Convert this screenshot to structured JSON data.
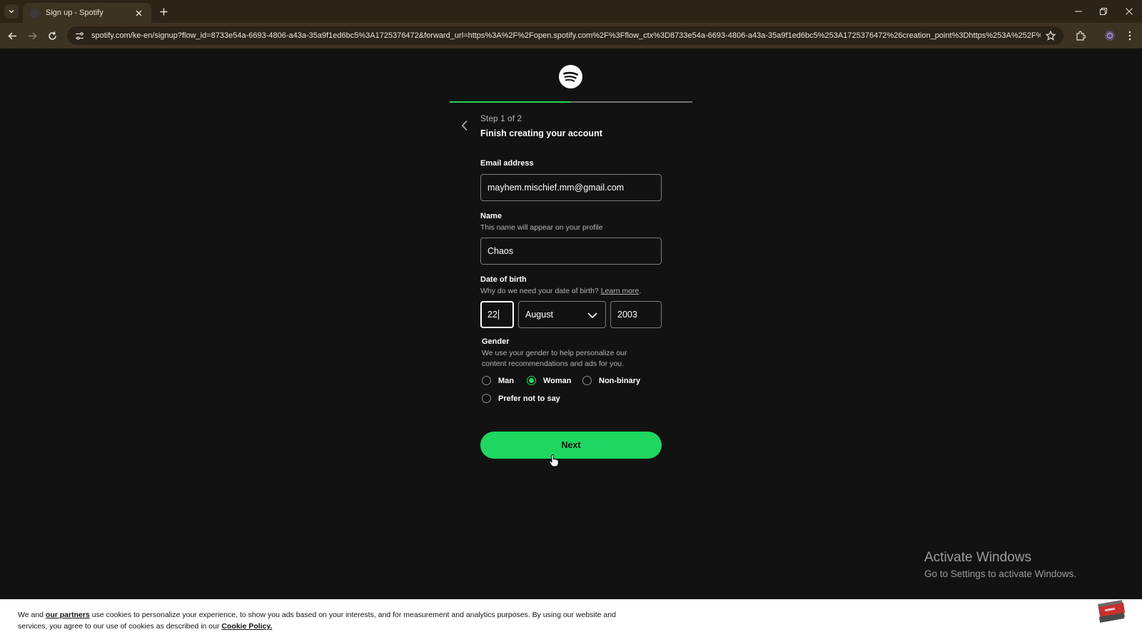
{
  "browser": {
    "tab_title": "Sign up - Spotify",
    "url": "spotify.com/ke-en/signup?flow_id=8733e54a-6693-4806-a43a-35a9f1ed6bc5%3A1725376472&forward_url=https%3A%2F%2Fopen.spotify.com%2F%3Fflow_ctx%3D8733e54a-6693-4806-a43a-35a9f1ed6bc5%253A1725376472%26creation_point%3Dhttps%253A%252F%252F..."
  },
  "signup": {
    "step": "Step 1 of 2",
    "heading": "Finish creating your account",
    "progress": 0.5,
    "email_label": "Email address",
    "email_value": "mayhem.mischief.mm@gmail.com",
    "name_label": "Name",
    "name_hint": "This name will appear on your profile",
    "name_value": "Chaos",
    "dob_label": "Date of birth",
    "dob_hint": "Why do we need your date of birth?",
    "dob_link": "Learn more",
    "dob_hint_end": ".",
    "dob_day": "22",
    "dob_month": "August",
    "dob_year": "2003",
    "gender_label": "Gender",
    "gender_hint": "We use your gender to help personalize our content recommendations and ads for you.",
    "gender_options": [
      "Man",
      "Woman",
      "Non-binary",
      "Prefer not to say"
    ],
    "gender_selected": "Woman",
    "next_label": "Next"
  },
  "watermark": {
    "title": "Activate Windows",
    "subtitle": "Go to Settings to activate Windows."
  },
  "cookie": {
    "part1": "We and ",
    "partners_link": "our partners",
    "part2": " use cookies to personalize your experience, to show you ads based on your interests, and for measurement and analytics purposes. By using our website and services, you agree to our use of cookies as described in our ",
    "policy_link": "Cookie Policy."
  },
  "icons": {
    "logo": "spotify-logo",
    "back": "chevron-left-icon",
    "select": "chevron-down-icon"
  },
  "colors": {
    "accent": "#1ed760",
    "background": "#121212",
    "chrome": "#3d3322"
  }
}
